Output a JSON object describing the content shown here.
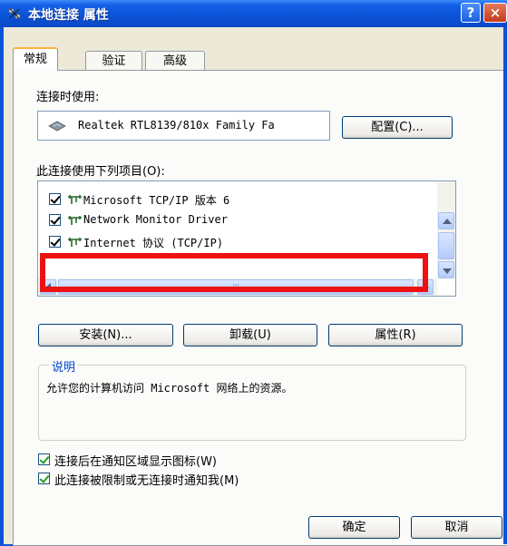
{
  "window": {
    "title": "本地连接 属性",
    "help_label": "?",
    "close_label": "×"
  },
  "tabs": [
    {
      "label": "常规",
      "active": true
    },
    {
      "label": "验证",
      "active": false
    },
    {
      "label": "高级",
      "active": false
    }
  ],
  "connect_using": {
    "label": "连接时使用:",
    "adapter": "Realtek RTL8139/810x Family Fa",
    "configure_label": "配置(C)..."
  },
  "items_section": {
    "label": "此连接使用下列项目(O):",
    "items": [
      {
        "label": "Microsoft TCP/IP 版本 6",
        "checked": true
      },
      {
        "label": "Network Monitor Driver",
        "checked": true
      },
      {
        "label": "Internet 协议 (TCP/IP)",
        "checked": true
      }
    ],
    "hscroll_grip": "III"
  },
  "buttons": {
    "install": "安装(N)...",
    "uninstall": "卸载(U)",
    "properties": "属性(R)",
    "ok": "确定",
    "cancel": "取消"
  },
  "description": {
    "title": "说明",
    "text": "允许您的计算机访问 Microsoft 网络上的资源。"
  },
  "options": [
    {
      "label": "连接后在通知区域显示图标(W)",
      "checked": true
    },
    {
      "label": "此连接被限制或无连接时通知我(M)",
      "checked": true
    }
  ],
  "colors": {
    "titlebar": "#0b53d8",
    "highlight_box": "#ee1111",
    "dialog_bg": "#ece9d8"
  }
}
